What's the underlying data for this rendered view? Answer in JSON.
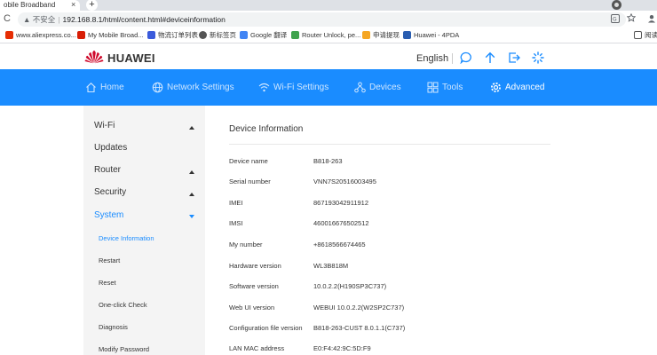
{
  "browser": {
    "tab_title": "obile Broadband",
    "tab_close": "×",
    "new_tab": "+",
    "back": "←",
    "reload": "C",
    "security_warning": "▲ 不安全",
    "url": "192.168.8.1/html/content.html#deviceinformation",
    "bookmarks": [
      {
        "label": "www.aliexpress.co...",
        "icon_color": "#e62e04"
      },
      {
        "label": "My Mobile Broad...",
        "icon_color": "#d81e06"
      },
      {
        "label": "物流订单列表",
        "icon_color": "#3b5bdb"
      },
      {
        "label": "新标签页",
        "icon_color": "#555555"
      },
      {
        "label": "Google 翻译",
        "icon_color": "#4285f4"
      },
      {
        "label": "Router Unlock, pe...",
        "icon_color": "#3fa34d"
      },
      {
        "label": "申请提现",
        "icon_color": "#f5a623"
      },
      {
        "label": "Huawei - 4PDA",
        "icon_color": "#2a5db0"
      }
    ],
    "reading_list": "阅读"
  },
  "header": {
    "brand": "HUAWEI",
    "language": "English",
    "brand_color": "#cf0a2c"
  },
  "nav": {
    "accent": "#1a8cff",
    "items": [
      {
        "label": "Home",
        "icon": "home-icon"
      },
      {
        "label": "Network Settings",
        "icon": "globe-icon"
      },
      {
        "label": "Wi-Fi Settings",
        "icon": "wifi-icon"
      },
      {
        "label": "Devices",
        "icon": "devices-icon"
      },
      {
        "label": "Tools",
        "icon": "tools-icon"
      },
      {
        "label": "Advanced",
        "icon": "gear-icon",
        "active": true
      }
    ]
  },
  "sidebar": {
    "items": [
      {
        "label": "Wi-Fi"
      },
      {
        "label": "Updates"
      },
      {
        "label": "Router"
      },
      {
        "label": "Security"
      },
      {
        "label": "System"
      }
    ],
    "subitems": [
      {
        "label": "Device Information",
        "active": true
      },
      {
        "label": "Restart"
      },
      {
        "label": "Reset"
      },
      {
        "label": "One-click Check"
      },
      {
        "label": "Diagnosis"
      },
      {
        "label": "Modify Password"
      }
    ]
  },
  "content": {
    "title": "Device Information",
    "rows": [
      {
        "label": "Device name",
        "value": "B818-263"
      },
      {
        "label": "Serial number",
        "value": "VNN7S20516003495"
      },
      {
        "label": "IMEI",
        "value": "867193042911912"
      },
      {
        "label": "IMSI",
        "value": "460016676502512"
      },
      {
        "label": "My number",
        "value": "+8618566674465"
      },
      {
        "label": "Hardware version",
        "value": "WL3B818M"
      },
      {
        "label": "Software version",
        "value": "10.0.2.2(H190SP3C737)"
      },
      {
        "label": "Web UI version",
        "value": "WEBUI 10.0.2.2(W2SP2C737)"
      },
      {
        "label": "Configuration file version",
        "value": "B818-263-CUST 8.0.1.1(C737)"
      },
      {
        "label": "LAN MAC address",
        "value": "E0:F4:42:9C:5D:F9"
      }
    ]
  }
}
